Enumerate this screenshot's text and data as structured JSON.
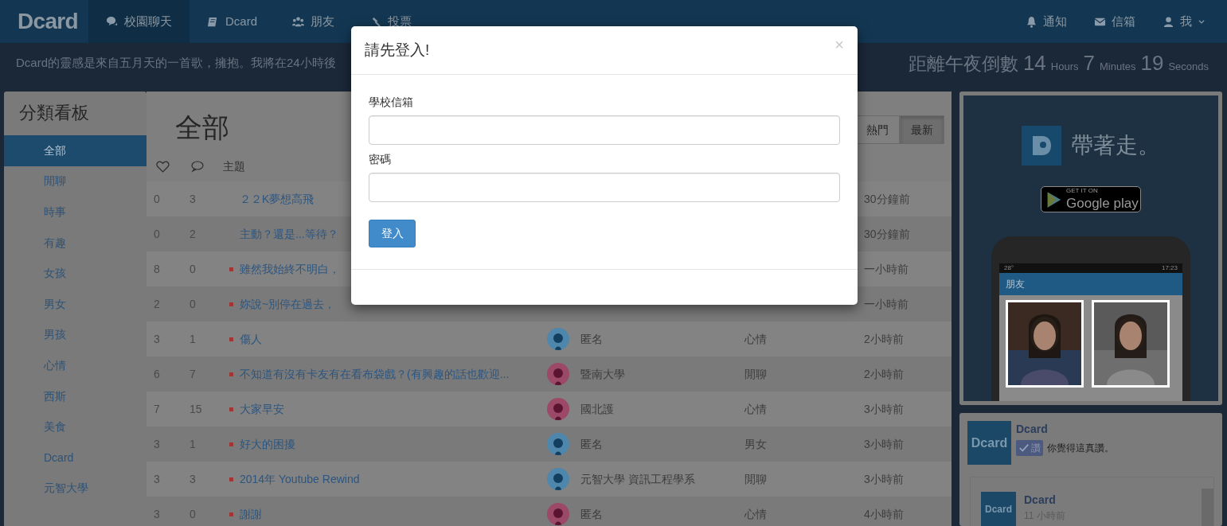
{
  "navbar": {
    "brand": "Dcard",
    "items": [
      {
        "label": "校園聊天",
        "selected": true
      },
      {
        "label": "Dcard",
        "selected": false
      },
      {
        "label": "朋友",
        "selected": false
      },
      {
        "label": "投票",
        "selected": false
      }
    ],
    "right_items": [
      {
        "label": "通知",
        "caret": false
      },
      {
        "label": "信箱",
        "caret": false
      },
      {
        "label": "我",
        "caret": true
      }
    ]
  },
  "announcement": "Dcard的靈感是來自五月天的一首歌，擁抱。我將在24小時後",
  "countdown": {
    "label": "距離午夜倒數",
    "parts": [
      {
        "value": "14",
        "unit": "Hours"
      },
      {
        "value": "7",
        "unit": "Minutes"
      },
      {
        "value": "19",
        "unit": "Seconds"
      }
    ]
  },
  "sidebar": {
    "title": "分類看板",
    "items": [
      {
        "label": "全部",
        "selected": true
      },
      {
        "label": "閒聊",
        "selected": false
      },
      {
        "label": "時事",
        "selected": false
      },
      {
        "label": "有趣",
        "selected": false
      },
      {
        "label": "女孩",
        "selected": false
      },
      {
        "label": "男女",
        "selected": false
      },
      {
        "label": "男孩",
        "selected": false
      },
      {
        "label": "心情",
        "selected": false
      },
      {
        "label": "西斯",
        "selected": false
      },
      {
        "label": "美食",
        "selected": false
      },
      {
        "label": "Dcard",
        "selected": false
      },
      {
        "label": "元智大學",
        "selected": false
      }
    ]
  },
  "board": {
    "title": "全部",
    "sort_tabs": [
      {
        "label": "熱門",
        "selected": false
      },
      {
        "label": "最新",
        "selected": true
      }
    ],
    "columns": {
      "topic": "主題"
    },
    "rows": [
      {
        "likes": "0",
        "comments": "3",
        "title": "２２K夢想高飛",
        "unread": false,
        "time": "30分鐘前"
      },
      {
        "likes": "0",
        "comments": "2",
        "title": "主動？還是...等待？",
        "unread": false,
        "time": "30分鐘前"
      },
      {
        "likes": "8",
        "comments": "0",
        "title": "雖然我始終不明白，",
        "unread": true,
        "time": "一小時前"
      },
      {
        "likes": "2",
        "comments": "0",
        "title": "妳說~別停在過去，",
        "unread": true,
        "time": "一小時前"
      },
      {
        "likes": "3",
        "comments": "1",
        "title": "傷人",
        "unread": true,
        "color": "#4f87ac",
        "author": "匿名",
        "category": "心情",
        "time": "2小時前"
      },
      {
        "likes": "6",
        "comments": "7",
        "title": "不知道有沒有卡友有在看布袋戲？(有興趣的話也歡迎...",
        "unread": true,
        "color": "#9c4867",
        "author": "暨南大學",
        "category": "閒聊",
        "time": "2小時前"
      },
      {
        "likes": "7",
        "comments": "15",
        "title": "大家早安",
        "unread": true,
        "color": "#9c4867",
        "author": "國北護",
        "category": "心情",
        "time": "3小時前"
      },
      {
        "likes": "3",
        "comments": "1",
        "title": "好大的困擾",
        "unread": true,
        "color": "#4f87ac",
        "author": "匿名",
        "category": "男女",
        "time": "3小時前"
      },
      {
        "likes": "3",
        "comments": "3",
        "title": "2014年 Youtube Rewind",
        "unread": true,
        "color": "#4f87ac",
        "author": "元智大學 資訊工程學系",
        "category": "閒聊",
        "time": "3小時前"
      },
      {
        "likes": "3",
        "comments": "0",
        "title": "謝謝",
        "unread": true,
        "color": "#9c4867",
        "author": "匿名",
        "category": "心情",
        "time": "4小時前"
      }
    ]
  },
  "ad": {
    "slogan": "帶著走。",
    "badge_top": "GET IT ON",
    "badge_main": "Google play",
    "phone": {
      "temperature": "28°",
      "clock": "17:23",
      "app_title": "朋友"
    }
  },
  "fb_widget": {
    "logo_text": "Dcard",
    "page_name": "Dcard",
    "like_label": "讚",
    "like_text": "你覺得這真讚。",
    "post": {
      "logo_text": "Dcard",
      "author": "Dcard",
      "time": "11 小時前"
    }
  },
  "modal": {
    "title": "請先登入!",
    "close": "×",
    "fields": [
      {
        "label": "學校信箱"
      },
      {
        "label": "密碼"
      }
    ],
    "submit": "登入"
  }
}
